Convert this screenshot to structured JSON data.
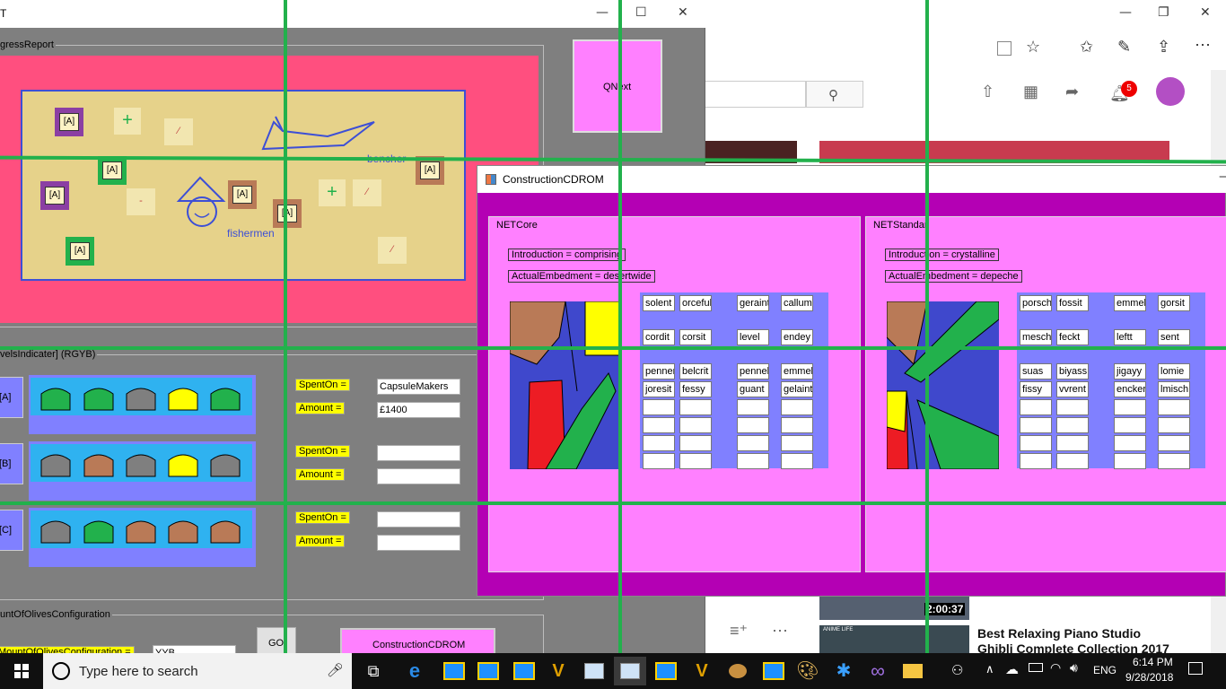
{
  "left_window": {
    "title": "T",
    "progress_group": "gressReport",
    "qnext_label": "QNext",
    "scene_labels": {
      "bencher": "bencher",
      "fishermen": "fishermen"
    },
    "tag_label": "[A]",
    "levels_group": "velsIndicater] (RGYB)",
    "rows": [
      {
        "label": "[A]",
        "spent_label": "SpentOn =",
        "amount_label": "Amount =",
        "spent_value": "CapsuleMakers",
        "amount_value": "£1400",
        "colors": [
          "#22b14c",
          "#22b14c",
          "#7f7f7f",
          "#ffff00",
          "#22b14c"
        ]
      },
      {
        "label": "[B]",
        "spent_label": "SpentOn =",
        "amount_label": "Amount =",
        "spent_value": "",
        "amount_value": "",
        "colors": [
          "#7f7f7f",
          "#b97a57",
          "#7f7f7f",
          "#ffff00",
          "#7f7f7f"
        ]
      },
      {
        "label": "[C]",
        "spent_label": "SpentOn =",
        "amount_label": "Amount =",
        "spent_value": "",
        "amount_value": "",
        "colors": [
          "#7f7f7f",
          "#22b14c",
          "#b97a57",
          "#b97a57",
          "#b97a57"
        ]
      }
    ],
    "olives_group": "untOfOlivesConfiguration",
    "olives_label": "MountOfOlivesConfiguration =",
    "olives_value": "YYB",
    "go_button": "GO",
    "construction_button": "ConstructionCDROM"
  },
  "browser": {
    "notification_count": "5",
    "video_duration": "2:00:37",
    "video_title_1": "Best Relaxing Piano Studio",
    "video_title_2": "Ghibli Complete Collection 2017",
    "thumb_small_label": "ANIME LIFE"
  },
  "cdrom_window": {
    "title": "ConstructionCDROM",
    "panels": [
      {
        "name": "NETCore",
        "introduction": "Introduction = comprising",
        "embedment": "ActualEmbedment = desertwide",
        "grid": [
          [
            "solent",
            "orceful",
            "geraint",
            "callum"
          ],
          [
            "cordit",
            "corsit",
            "level",
            "endey"
          ],
          [
            "penner",
            "belcrit",
            "pennel",
            "emmel"
          ],
          [
            "joresit",
            "fessy",
            "guant",
            "gelaint"
          ]
        ]
      },
      {
        "name": "NETStandar",
        "introduction": "Introduction = crystalline",
        "embedment": "ActualEmbedment = depeche",
        "grid": [
          [
            "porsch",
            "fossit",
            "emmel",
            "gorsit"
          ],
          [
            "mesch",
            "feckt",
            "leftt",
            "sent"
          ],
          [
            "suas",
            "biyass",
            "jigayy",
            "lomie"
          ],
          [
            "fissy",
            "vvrent",
            "encker",
            "lmisch"
          ]
        ]
      }
    ]
  },
  "taskbar": {
    "search_placeholder": "Type here to search",
    "language": "ENG",
    "time": "6:14 PM",
    "date": "9/28/2018"
  },
  "colors": {
    "magenta": "#ff80ff",
    "purple": "#b400b4",
    "pink": "#ff4f7f",
    "periwinkle": "#8080ff",
    "cyan": "#2fb2f0",
    "gridline": "#22b14c"
  }
}
